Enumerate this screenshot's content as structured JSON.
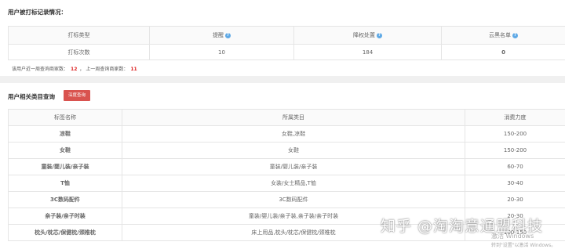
{
  "section1": {
    "title": "用户被打标记录情况：",
    "headers": [
      {
        "label": "打标类型",
        "help": false
      },
      {
        "label": "提醒",
        "help": true
      },
      {
        "label": "降权处置",
        "help": true
      },
      {
        "label": "云黑名单",
        "help": true
      }
    ],
    "row": {
      "type": "打标次数",
      "remind": "10",
      "demote": "184",
      "blacklist": "0"
    },
    "fav_line": {
      "label1": "该用户近一周查询商家数：",
      "value1": "12",
      "sep": "，",
      "label2": "上一周查询商家数：",
      "value2": "11"
    }
  },
  "section2": {
    "title": "用户相关类目查询",
    "button_label": "深度查询",
    "headers": [
      "标签名称",
      "所属类目",
      "消费力度"
    ],
    "rows": [
      {
        "name": "凉鞋",
        "category": "女鞋,凉鞋",
        "power": "150-200"
      },
      {
        "name": "女鞋",
        "category": "女鞋",
        "power": "150-200"
      },
      {
        "name": "童装/婴儿装/亲子装",
        "category": "童装/婴儿装/亲子装",
        "power": "60-70"
      },
      {
        "name": "T恤",
        "category": "女装/女士精品,T恤",
        "power": "30-40"
      },
      {
        "name": "3C数码配件",
        "category": "3C数码配件",
        "power": "20-30"
      },
      {
        "name": "亲子装/亲子时装",
        "category": "童装/婴儿装/亲子装,亲子装/亲子时装",
        "power": "20-30"
      },
      {
        "name": "枕头/枕芯/保健枕/颈椎枕",
        "category": "床上用品,枕头/枕芯/保健枕/颈椎枕",
        "power": "100-150"
      }
    ]
  },
  "watermark": "知乎 @淘淘意通盟科技",
  "windows_notice": {
    "line1": "激活 Windows",
    "line2": "转到\"设置\"以激活 Windows。"
  },
  "colors": {
    "accent_red": "#d22",
    "help_blue": "#5ea9e6",
    "button_red": "#d9534f"
  }
}
